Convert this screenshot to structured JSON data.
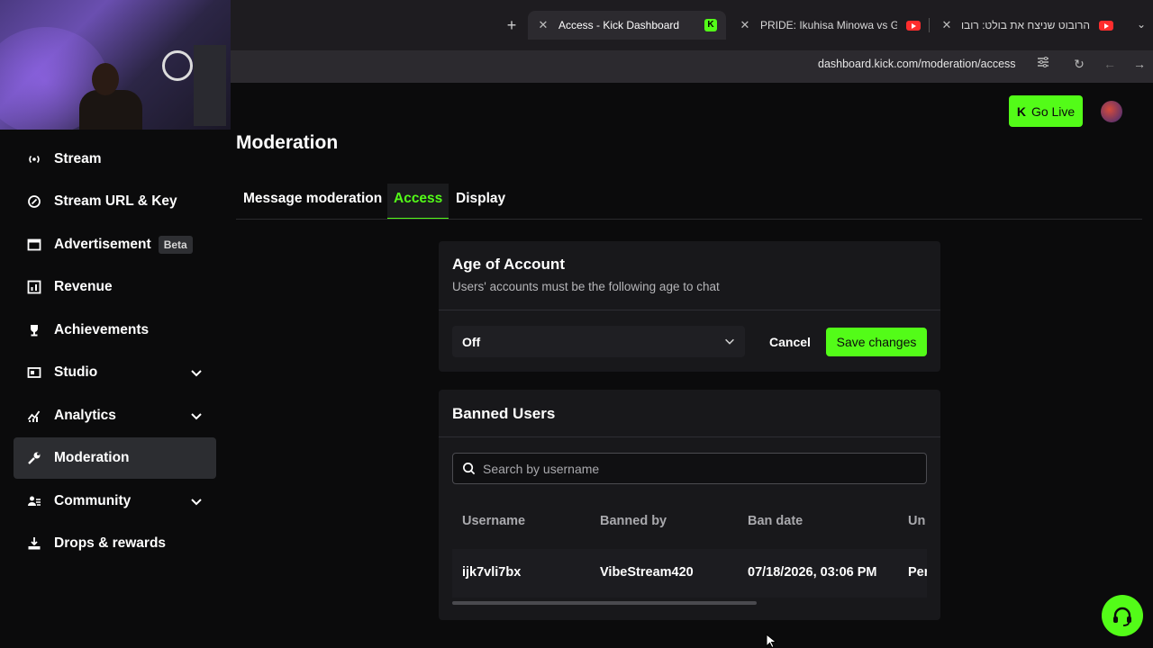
{
  "browser": {
    "tabs": [
      {
        "title": "Access - Kick Dashboard",
        "favicon": "kick-icon",
        "active": true
      },
      {
        "title": "PRIDE: Ikuhisa Minowa vs Giant",
        "favicon": "youtube-icon",
        "active": false
      },
      {
        "title": "הרובוט שניצח את בולט: רובוט ס",
        "favicon": "youtube-icon",
        "active": false
      }
    ],
    "url": "dashboard.kick.com/moderation/access"
  },
  "header": {
    "go_live_label": "Go Live"
  },
  "sidebar": {
    "items": [
      {
        "label": "Stream",
        "icon": "broadcast-icon",
        "expandable": false
      },
      {
        "label": "Stream URL & Key",
        "icon": "link-icon",
        "expandable": false
      },
      {
        "label": "Advertisement",
        "icon": "ad-icon",
        "badge": "Beta",
        "expandable": false
      },
      {
        "label": "Revenue",
        "icon": "bar-chart-icon",
        "expandable": false
      },
      {
        "label": "Achievements",
        "icon": "trophy-icon",
        "expandable": false
      },
      {
        "label": "Studio",
        "icon": "studio-icon",
        "expandable": true
      },
      {
        "label": "Analytics",
        "icon": "analytics-icon",
        "expandable": true
      },
      {
        "label": "Moderation",
        "icon": "wrench-icon",
        "expandable": false,
        "active": true
      },
      {
        "label": "Community",
        "icon": "community-icon",
        "expandable": true
      },
      {
        "label": "Drops & rewards",
        "icon": "drops-icon",
        "expandable": false
      }
    ]
  },
  "main": {
    "title": "Moderation",
    "tabs": [
      {
        "label": "Message moderation",
        "active": false
      },
      {
        "label": "Access",
        "active": true
      },
      {
        "label": "Display",
        "active": false
      }
    ],
    "age_card": {
      "title": "Age of Account",
      "subtitle": "Users' accounts must be the following age to chat",
      "select_value": "Off",
      "cancel_label": "Cancel",
      "save_label": "Save changes"
    },
    "banned_card": {
      "title": "Banned Users",
      "search_placeholder": "Search by username",
      "columns": [
        "Username",
        "Banned by",
        "Ban date",
        "Un"
      ],
      "rows": [
        {
          "username": "ijk7vli7bx",
          "banned_by": "VibeStream420",
          "ban_date": "07/18/2026, 03:06 PM",
          "unban": "Per"
        }
      ]
    }
  },
  "colors": {
    "accent": "#53fc18",
    "background": "#0b0b0c",
    "card": "#18181b"
  }
}
